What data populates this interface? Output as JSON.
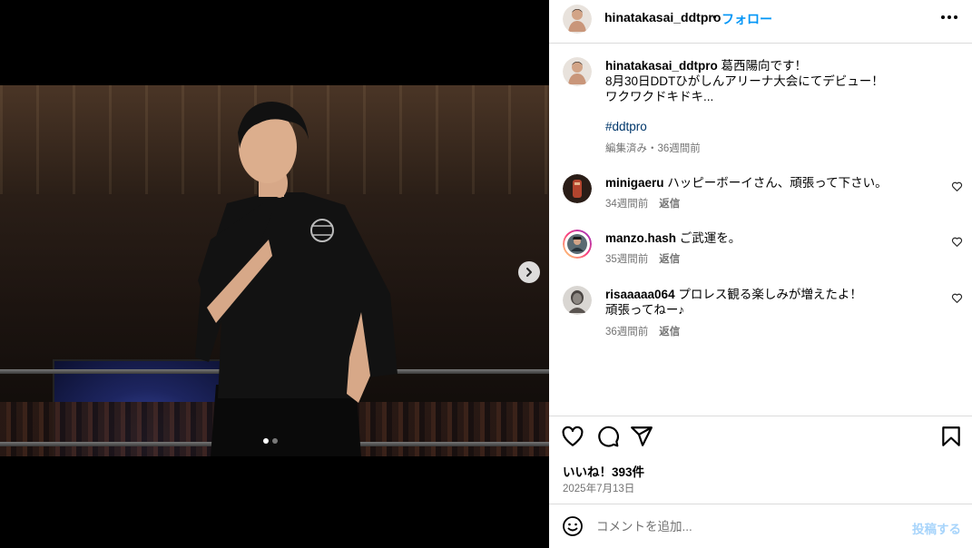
{
  "post": {
    "username": "hinatakasai_ddtpro",
    "separator": "•",
    "follow_label": "フォロー",
    "caption_lines": [
      "葛西陽向です！",
      "8月30日DDTひがしんアリーナ大会にてデビュー！",
      "ワクワクドキドキ..."
    ],
    "hashtag": "#ddtpro",
    "caption_meta": "編集済み・36週間前",
    "likes_label": "いいね！393件",
    "date": "2025年7月13日"
  },
  "comments": [
    {
      "username": "minigaeru",
      "text": "ハッピーボーイさん、頑張って下さい。",
      "time": "34週間前",
      "reply": "返信"
    },
    {
      "username": "manzo.hash",
      "text": "ご武運を。",
      "time": "35週間前",
      "reply": "返信"
    },
    {
      "username": "risaaaaa064",
      "text": "プロレス観る楽しみが増えたよ！",
      "text2": "頑張ってねー♪",
      "time": "36週間前",
      "reply": "返信"
    }
  ],
  "add_comment": {
    "placeholder": "コメントを追加...",
    "post_label": "投稿する"
  },
  "carousel": {
    "current": 1,
    "total": 2
  },
  "colors": {
    "accent": "#0095f6",
    "muted": "#737373",
    "hashtag": "#00376b",
    "divider": "#dbdbdb"
  },
  "icons": [
    "more-options-icon",
    "heart-icon",
    "comment-icon",
    "share-icon",
    "bookmark-icon",
    "emoji-icon",
    "chevron-right-icon"
  ]
}
